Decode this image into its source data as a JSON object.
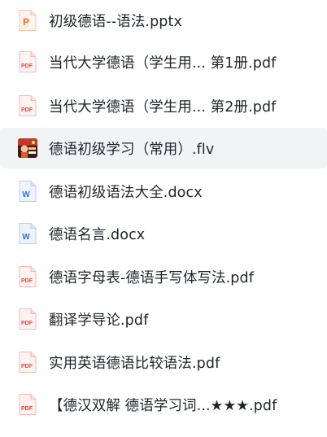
{
  "files": [
    {
      "name": "初级德语--语法.pptx",
      "type": "pptx",
      "icon": "pptx-file-icon",
      "highlighted": false
    },
    {
      "name": "当代大学德语（学生用... 第1册.pdf",
      "type": "pdf",
      "icon": "pdf-file-icon",
      "highlighted": false
    },
    {
      "name": "当代大学德语（学生用... 第2册.pdf",
      "type": "pdf",
      "icon": "pdf-file-icon",
      "highlighted": false
    },
    {
      "name": "德语初级学习（常用）.flv",
      "type": "flv",
      "icon": "video-thumbnail-icon",
      "highlighted": true
    },
    {
      "name": "德语初级语法大全.docx",
      "type": "docx",
      "icon": "word-file-icon",
      "highlighted": false
    },
    {
      "name": "德语名言.docx",
      "type": "docx",
      "icon": "word-file-icon",
      "highlighted": false
    },
    {
      "name": "德语字母表-德语手写体写法.pdf",
      "type": "pdf",
      "icon": "pdf-file-icon",
      "highlighted": false
    },
    {
      "name": "翻译学导论.pdf",
      "type": "pdf",
      "icon": "pdf-file-icon",
      "highlighted": false
    },
    {
      "name": "实用英语德语比较语法.pdf",
      "type": "pdf",
      "icon": "pdf-file-icon",
      "highlighted": false
    },
    {
      "name": "【德汉双解 德语学习词...★★★.pdf",
      "type": "pdf",
      "icon": "pdf-file-icon",
      "highlighted": false
    }
  ],
  "icon_labels": {
    "pdf": "PDF",
    "pptx": "P",
    "docx": "W"
  },
  "colors": {
    "pdf": "#e8453c",
    "pptx": "#f06b24",
    "docx": "#2f6fe4",
    "highlight": "#f2f3f5",
    "text": "#1f2329"
  }
}
